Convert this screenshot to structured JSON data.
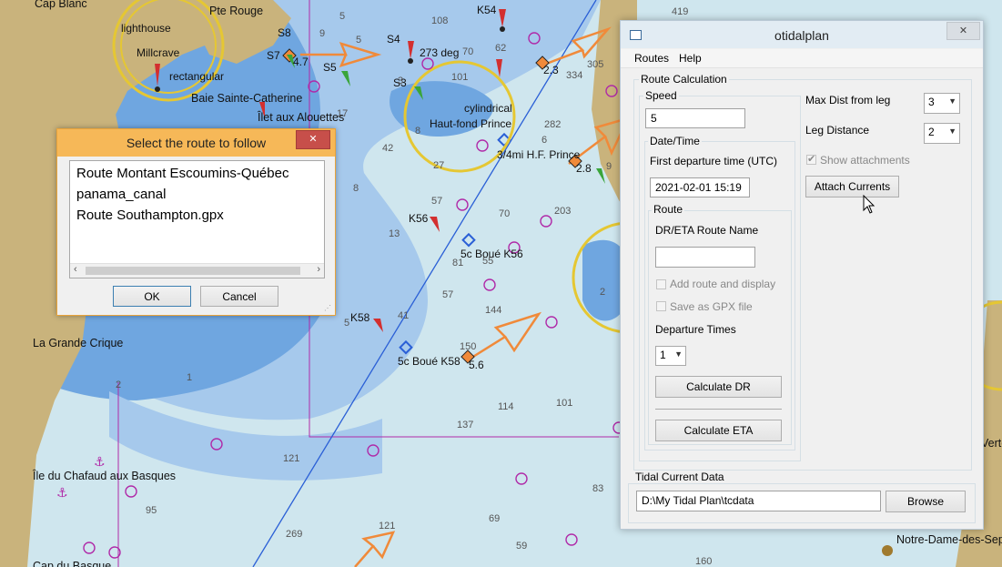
{
  "chart": {
    "place_names": [
      "Cap Blanc",
      "Pte Rouge",
      "Baie Sainte-Catherine",
      "Îlet aux Alouettes",
      "La Grande Crique",
      "Île du Chafaud aux Basques",
      "Notre-Dame-des-Sep",
      "Cap du Basque",
      "Vertè"
    ],
    "beacon_labels": [
      "S8",
      "S7",
      "S4",
      "S3",
      "S5",
      "K54",
      "K56",
      "K58",
      "Haut-fond Prince"
    ],
    "feature_labels": [
      "cylindrical",
      "rectangular",
      "Millcrave",
      "lighthouse"
    ],
    "route_labels": [
      "3/4mi H.F. Prince",
      "5c Boué K56",
      "5c Boué K58"
    ],
    "current_labels": [
      "4.7",
      "2.3",
      "2.8",
      "5.6"
    ],
    "bearing_label": "273 deg",
    "depths": [
      "108",
      "419",
      "70",
      "62",
      "5",
      "9",
      "101",
      "305",
      "334",
      "282",
      "6",
      "42",
      "27",
      "8",
      "57",
      "70",
      "13",
      "81",
      "55",
      "57",
      "41",
      "203",
      "144",
      "150",
      "114",
      "101",
      "137",
      "121",
      "95",
      "83",
      "69",
      "59",
      "121",
      "269",
      "160",
      "2",
      "1",
      "2",
      "5",
      "9",
      "3",
      "17",
      "5",
      "8"
    ]
  },
  "route_dialog": {
    "title": "Select the route to follow",
    "routes": [
      "Route Montant Escoumins-Québec",
      "panama_canal",
      "Route Southampton.gpx"
    ],
    "ok_label": "OK",
    "cancel_label": "Cancel",
    "close_label": "✕"
  },
  "otidalplan": {
    "title": "otidalplan",
    "close_label": "✕",
    "menu": [
      "Routes",
      "Help"
    ],
    "route_calc_label": "Route Calculation",
    "speed_label": "Speed",
    "speed_value": "5",
    "datetime_label": "Date/Time",
    "first_departure_label": "First departure time (UTC)",
    "first_departure_value": "2021-02-01  15:19",
    "route_group_label": "Route",
    "route_name_label": "DR/ETA Route Name",
    "route_name_value": "",
    "add_route_label": "Add route and display",
    "save_gpx_label": "Save as GPX file",
    "departure_times_label": "Departure Times",
    "departure_times_value": "1",
    "calc_dr_label": "Calculate DR",
    "calc_eta_label": "Calculate ETA",
    "max_dist_label": "Max Dist from leg",
    "max_dist_value": "3",
    "leg_distance_label": "Leg Distance",
    "leg_distance_value": "2",
    "show_attachments_label": "Show attachments",
    "attach_currents_label": "Attach Currents",
    "tidal_data_label": "Tidal Current Data",
    "tidal_path_value": "D:\\My Tidal Plan\\tcdata",
    "browse_label": "Browse"
  },
  "colors": {
    "land": "#c9b37c",
    "shallow": "#6fa6e0",
    "medium": "#a6c9ec",
    "deep": "#cfe6ee",
    "current_arrow": "#f08a3a",
    "route_line": "#2a5fd6",
    "magenta": "#b02aa8"
  }
}
